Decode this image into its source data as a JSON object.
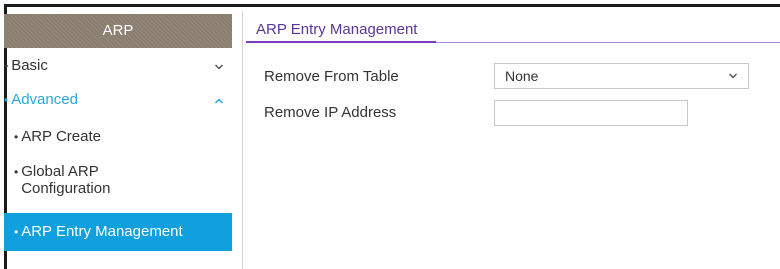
{
  "sidebar": {
    "header": "ARP",
    "basic_label": "Basic",
    "advanced_label": "Advanced",
    "bullet": "•",
    "items": [
      {
        "label": "ARP Create"
      },
      {
        "label": "Global ARP"
      },
      {
        "label": "Configuration"
      },
      {
        "label": "ARP Entry Management"
      }
    ]
  },
  "main": {
    "title": "ARP Entry Management",
    "remove_from_table_label": "Remove From Table",
    "remove_from_table_value": "None",
    "remove_ip_label": "Remove IP Address",
    "remove_ip_value": ""
  },
  "colors": {
    "header_bg": "#8a7e70",
    "active_bg": "#10a0dd",
    "advanced_text": "#29a7df",
    "title_text": "#5c3696",
    "title_rule": "#b48ad8"
  },
  "icons": {
    "basic_toggle": "chevron-down-icon",
    "advanced_toggle": "chevron-up-icon",
    "select_toggle": "chevron-down-icon"
  }
}
